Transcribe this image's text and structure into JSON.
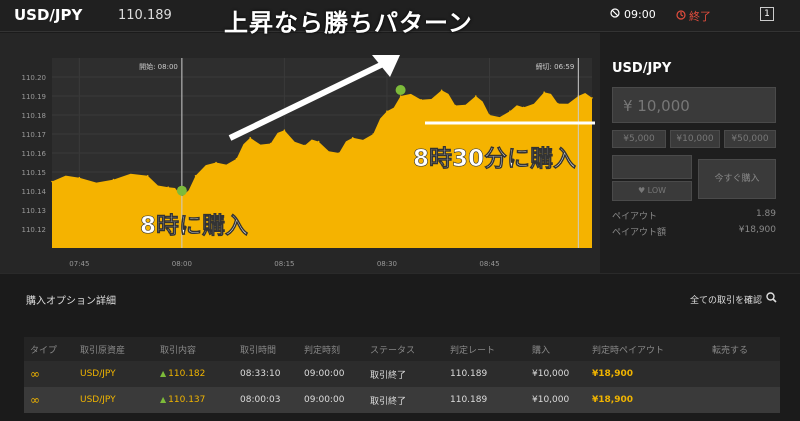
{
  "header": {
    "pair": "USD/JPY",
    "price": "110.189",
    "timer": "09:00",
    "end_label": "終了",
    "overlay_title": "上昇なら勝ちパターン"
  },
  "chart": {
    "start_label": "開始: 08:00",
    "end_label": "締切: 06:59",
    "y_ticks": [
      "110.20",
      "110.19",
      "110.18",
      "110.17",
      "110.16",
      "110.15",
      "110.14",
      "110.13",
      "110.12"
    ],
    "x_ticks": [
      "07:45",
      "08:00",
      "08:15",
      "08:30",
      "08:45"
    ],
    "annotation_1": "8時に購入",
    "annotation_2": "8時30分に購入",
    "fill_color": "#f5b300"
  },
  "chart_data": {
    "type": "area",
    "title": "",
    "xlabel": "",
    "ylabel": "",
    "ylim": [
      110.11,
      110.21
    ],
    "x": [
      "07:41",
      "07:45",
      "07:50",
      "07:55",
      "07:58",
      "08:00",
      "08:02",
      "08:05",
      "08:08",
      "08:10",
      "08:13",
      "08:15",
      "08:18",
      "08:20",
      "08:23",
      "08:25",
      "08:28",
      "08:30",
      "08:32",
      "08:35",
      "08:38",
      "08:40",
      "08:43",
      "08:45",
      "08:48",
      "08:50",
      "08:53",
      "08:55",
      "08:58",
      "09:00"
    ],
    "values": [
      110.145,
      110.147,
      110.146,
      110.148,
      110.142,
      110.137,
      110.148,
      110.155,
      110.157,
      110.168,
      110.165,
      110.172,
      110.164,
      110.166,
      110.16,
      110.168,
      110.17,
      110.182,
      110.19,
      110.188,
      110.193,
      110.185,
      110.19,
      110.18,
      110.182,
      110.184,
      110.192,
      110.186,
      110.19,
      110.189
    ]
  },
  "side": {
    "pair": "USD/JPY",
    "amount": "¥ 10,000",
    "quick_1": "¥5,000",
    "quick_2": "¥10,000",
    "quick_3": "¥50,000",
    "low_label": "LOW",
    "buy_now": "今すぐ購入",
    "payout_label": "ペイアウト",
    "payout_value": "1.89",
    "payout_amount_label": "ペイアウト額",
    "payout_amount_value": "¥18,900"
  },
  "details": {
    "title": "購入オプション詳細",
    "link": "全ての取引を確認"
  },
  "table": {
    "headers": {
      "type": "タイプ",
      "asset": "取引原資産",
      "content": "取引内容",
      "time": "取引時間",
      "judge": "判定時刻",
      "status": "ステータス",
      "rate": "判定レート",
      "buy": "購入",
      "payout": "判定時ペイアウト",
      "sell": "転売する"
    },
    "rows": [
      {
        "asset": "USD/JPY",
        "content": "110.182",
        "time": "08:33:10",
        "judge": "09:00:00",
        "status": "取引終了",
        "rate": "110.189",
        "buy": "¥10,000",
        "payout": "¥18,900"
      },
      {
        "asset": "USD/JPY",
        "content": "110.137",
        "time": "08:00:03",
        "judge": "09:00:00",
        "status": "取引終了",
        "rate": "110.189",
        "buy": "¥10,000",
        "payout": "¥18,900"
      }
    ]
  }
}
